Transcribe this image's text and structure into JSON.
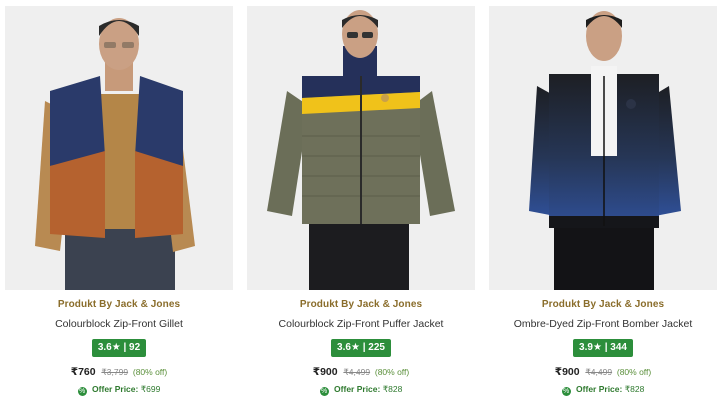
{
  "products": [
    {
      "brand": "Produkt By Jack & Jones",
      "name": "Colourblock Zip-Front Gillet",
      "rating": "3.6★ | 92",
      "price": "₹760",
      "mrp": "₹3,799",
      "discount": "(80% off)",
      "offer_label": "Offer Price:",
      "offer_price": "₹699"
    },
    {
      "brand": "Produkt By Jack & Jones",
      "name": "Colourblock Zip-Front Puffer Jacket",
      "rating": "3.6★ | 225",
      "price": "₹900",
      "mrp": "₹4,499",
      "discount": "(80% off)",
      "offer_label": "Offer Price:",
      "offer_price": "₹828"
    },
    {
      "brand": "Produkt By Jack & Jones",
      "name": "Ombre-Dyed Zip-Front Bomber Jacket",
      "rating": "3.9★ | 344",
      "price": "₹900",
      "mrp": "₹4,499",
      "discount": "(80% off)",
      "offer_label": "Offer Price:",
      "offer_price": "₹828"
    }
  ],
  "colors": {
    "brand_text": "#8a6d2b",
    "rating_badge": "#2c8e3b",
    "discount_text": "#5a8f3a"
  },
  "icons": {
    "offer": "offer-tag-icon"
  }
}
